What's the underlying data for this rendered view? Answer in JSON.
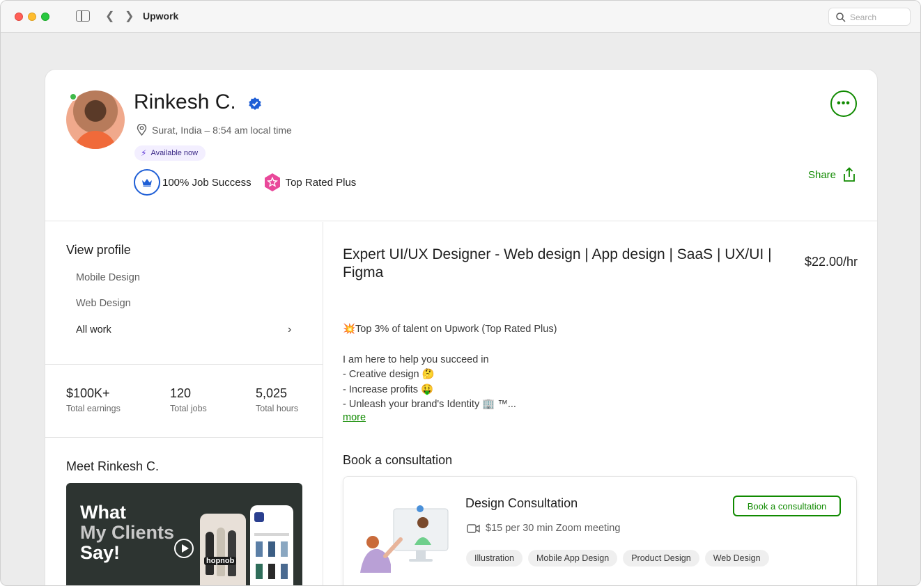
{
  "window": {
    "title": "Upwork",
    "search_placeholder": "Search"
  },
  "profile": {
    "name": "Rinkesh C.",
    "location": "Surat, India – 8:54 am local time",
    "availability": "Available now",
    "job_success": "100% Job Success",
    "top_rated": "Top Rated Plus",
    "share_label": "Share",
    "more_menu": "•••"
  },
  "sidebar": {
    "view_profile_title": "View profile",
    "items": [
      {
        "label": "Mobile Design"
      },
      {
        "label": "Web Design"
      },
      {
        "label": "All work"
      }
    ],
    "stats": [
      {
        "value": "$100K+",
        "label": "Total earnings"
      },
      {
        "value": "120",
        "label": "Total jobs"
      },
      {
        "value": "5,025",
        "label": "Total hours"
      }
    ],
    "meet_title": "Meet Rinkesh C.",
    "video": {
      "line1": "What",
      "line2": "My Clients",
      "line3": "Say!",
      "brand": "hopnob"
    }
  },
  "main": {
    "headline": "Expert UI/UX Designer - Web design | App design | SaaS | UX/UI | Figma",
    "rate": "$22.00/hr",
    "overview": [
      "💥Top 3% of talent on Upwork (Top Rated Plus)",
      "",
      "I am here to help you succeed in",
      "- Creative design 🤔",
      "- Increase profits 🤑",
      "- Unleash your brand's Identity 🏢 ™..."
    ],
    "more_label": "more",
    "consultation": {
      "section_title": "Book a consultation",
      "title": "Design Consultation",
      "meta": "$15 per 30 min Zoom meeting",
      "button": "Book a consultation",
      "tags": [
        "Illustration",
        "Mobile App Design",
        "Product Design",
        "Web Design"
      ]
    }
  },
  "colors": {
    "brand_green": "#108a00",
    "verified_blue": "#1f5fd6",
    "online": "#3fba4a",
    "top_rated_pink": "#e9489a"
  },
  "icons": [
    "sidebar-toggle-icon",
    "back-icon",
    "forward-icon",
    "search-icon",
    "verified-icon",
    "location-pin-icon",
    "lightning-icon",
    "crown-icon",
    "top-rated-plus-icon",
    "share-icon",
    "chevron-right-icon",
    "play-icon",
    "video-call-icon"
  ]
}
